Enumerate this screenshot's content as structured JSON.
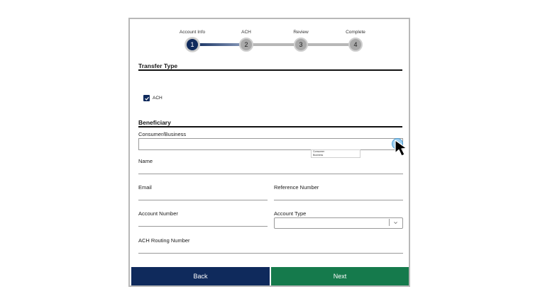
{
  "stepper": {
    "steps": [
      {
        "label": "Account Info",
        "number": "1",
        "state": "active"
      },
      {
        "label": "ACH",
        "number": "2",
        "state": "inactive"
      },
      {
        "label": "Review",
        "number": "3",
        "state": "inactive"
      },
      {
        "label": "Complete",
        "number": "4",
        "state": "inactive"
      }
    ]
  },
  "transfer_type": {
    "title": "Transfer Type",
    "ach_checkbox": {
      "label": "ACH",
      "checked": true
    }
  },
  "beneficiary": {
    "title": "Beneficiary",
    "consumer_business": {
      "label": "Consumer/Business",
      "value": "",
      "options": [
        "Consumer",
        "Business"
      ]
    },
    "name": {
      "label": "Name",
      "value": ""
    },
    "email": {
      "label": "Email",
      "value": ""
    },
    "reference_number": {
      "label": "Reference Number",
      "value": ""
    },
    "account_number": {
      "label": "Account Number",
      "value": ""
    },
    "account_type": {
      "label": "Account Type",
      "value": ""
    },
    "ach_routing_number": {
      "label": "ACH Routing Number",
      "value": ""
    }
  },
  "buttons": {
    "back": "Back",
    "next": "Next"
  },
  "colors": {
    "primary_navy": "#0f2a5c",
    "next_green": "#157a4c",
    "inactive_step": "#a9a9a9"
  }
}
